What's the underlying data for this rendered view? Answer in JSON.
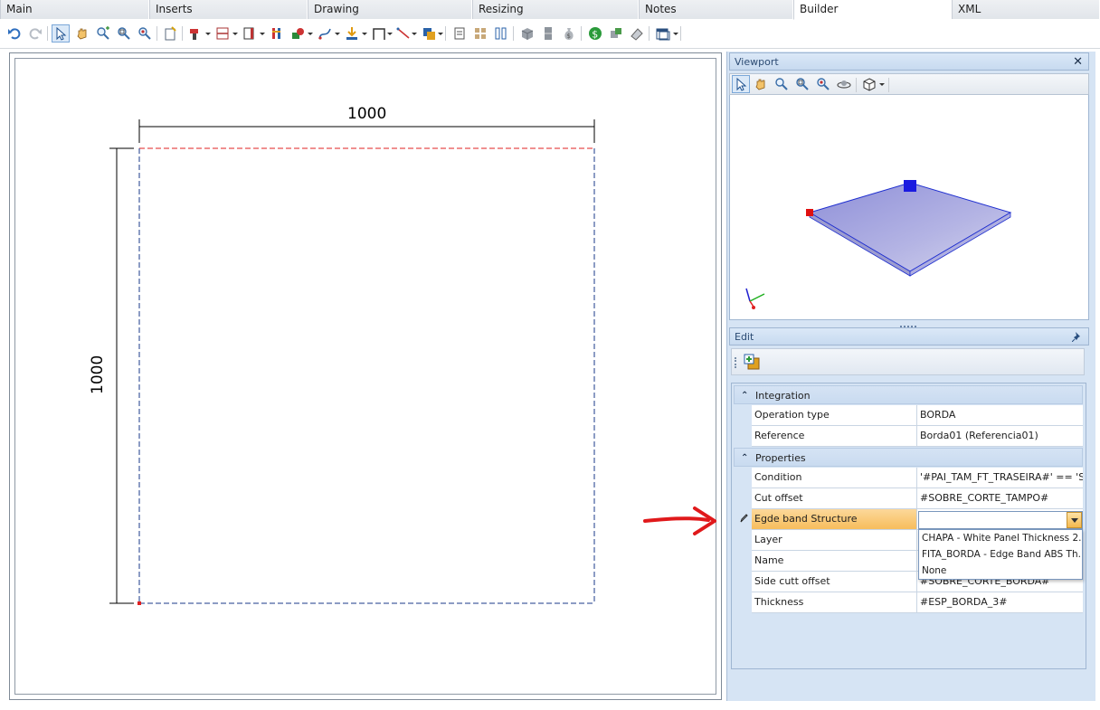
{
  "tabs": [
    "Main",
    "Inserts",
    "Drawing",
    "Resizing",
    "Notes",
    "Builder",
    "XML"
  ],
  "active_tab": "Builder",
  "toolbar": {
    "icons": [
      "undo-icon",
      "redo-icon",
      "select-icon",
      "pan-icon",
      "zoom-extents-icon",
      "zoom-window-icon",
      "zoom-icon",
      "new-note-icon",
      "drill-icon",
      "divider-icon",
      "panel-icon",
      "rack-icon",
      "material-icon",
      "curve-icon",
      "insert-down-icon",
      "frame-icon",
      "line-icon",
      "copy-icon",
      "export-icon",
      "grid-icon",
      "columns-icon",
      "box-icon",
      "cabinet-icon",
      "money-bag-icon",
      "price-icon",
      "parts-icon",
      "eraser-icon",
      "window-icon"
    ]
  },
  "drawing": {
    "width_dimension": "1000",
    "height_dimension": "1000"
  },
  "viewport": {
    "title": "Viewport",
    "close_glyph": "✕"
  },
  "edit": {
    "title": "Edit",
    "categories": [
      {
        "label": "Integration",
        "rows": [
          {
            "name": "Operation type",
            "value": "BORDA"
          },
          {
            "name": "Reference",
            "value": "Borda01 (Referencia01)"
          }
        ]
      },
      {
        "label": "Properties",
        "rows": [
          {
            "name": "Condition",
            "value": "'#PAI_TAM_FT_TRASEIRA#' == 'SIM'"
          },
          {
            "name": "Cut offset",
            "value": "#SOBRE_CORTE_TAMPO#"
          },
          {
            "name": "Egde band Structure",
            "value": ""
          },
          {
            "name": "Layer",
            "value": ""
          },
          {
            "name": "Name",
            "value": ""
          },
          {
            "name": "Side cutt offset",
            "value": "#SOBRE_CORTE_BORDA#"
          },
          {
            "name": "Thickness",
            "value": "#ESP_BORDA_3#"
          }
        ]
      }
    ],
    "dropdown_options": [
      "CHAPA - White Panel Thickness 2...",
      "FITA_BORDA - Edge Band ABS Th...",
      "None"
    ]
  },
  "colors": {
    "accent_selected_row": "#f7bd5c",
    "panel_bg": "#d6e4f4",
    "panel_top_face": "#a6a6e0",
    "arrow": "#e0191b"
  }
}
